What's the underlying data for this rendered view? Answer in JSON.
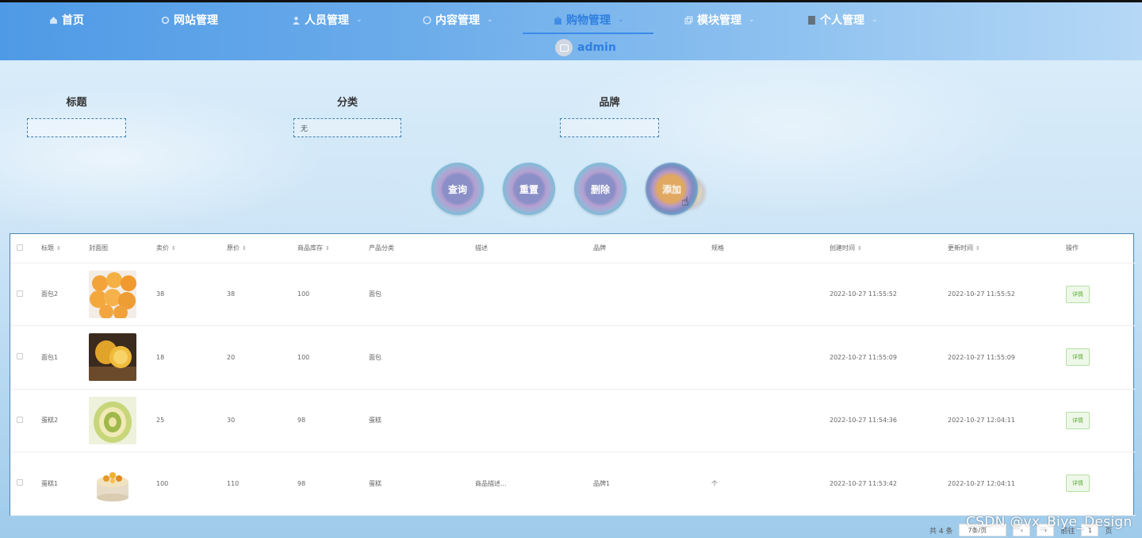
{
  "nav": {
    "items": [
      {
        "label": "首页",
        "icon": "home-icon"
      },
      {
        "label": "网站管理",
        "icon": "gear-icon"
      },
      {
        "label": "人员管理",
        "icon": "user-icon"
      },
      {
        "label": "内容管理",
        "icon": "chat-icon"
      },
      {
        "label": "购物管理",
        "icon": "bag-icon"
      },
      {
        "label": "模块管理",
        "icon": "copy-icon"
      },
      {
        "label": "个人管理",
        "icon": "doc-icon"
      }
    ],
    "active": "购物管理"
  },
  "user": {
    "name": "admin"
  },
  "search": {
    "title_label": "标题",
    "title_value": "",
    "category_label": "分类",
    "category_value": "无",
    "brand_label": "品牌",
    "brand_value": ""
  },
  "actions": {
    "query": "查询",
    "reset": "重置",
    "delete": "删除",
    "add": "添加"
  },
  "table": {
    "headers": [
      "标题",
      "封面图",
      "卖价",
      "原价",
      "商品库存",
      "产品分类",
      "描述",
      "品牌",
      "规格",
      "创建时间",
      "更新时间",
      "操作"
    ],
    "rows": [
      {
        "title": "面包2",
        "cover": "bread-buns",
        "price": "38",
        "orig": "38",
        "stock": "100",
        "category": "面包",
        "desc": "",
        "brand": "",
        "spec": "",
        "created": "2022-10-27 11:55:52",
        "updated": "2022-10-27 11:55:52",
        "action": "详情"
      },
      {
        "title": "面包1",
        "cover": "bread-halves",
        "price": "18",
        "orig": "20",
        "stock": "100",
        "category": "面包",
        "desc": "",
        "brand": "",
        "spec": "",
        "created": "2022-10-27 11:55:09",
        "updated": "2022-10-27 11:55:09",
        "action": "详情"
      },
      {
        "title": "蛋糕2",
        "cover": "cake-roll",
        "price": "25",
        "orig": "30",
        "stock": "98",
        "category": "蛋糕",
        "desc": "",
        "brand": "",
        "spec": "",
        "created": "2022-10-27 11:54:36",
        "updated": "2022-10-27 12:04:11",
        "action": "详情"
      },
      {
        "title": "蛋糕1",
        "cover": "round-cake",
        "price": "100",
        "orig": "110",
        "stock": "98",
        "category": "蛋糕",
        "desc": "商品描述...",
        "brand": "品牌1",
        "spec": "个",
        "created": "2022-10-27 11:53:42",
        "updated": "2022-10-27 12:04:11",
        "action": "详情"
      }
    ]
  },
  "pager": {
    "total": "共 4 条",
    "page_size": "7条/页",
    "goto": "前往",
    "page": "1",
    "page_suffix": "页"
  },
  "watermark": "CSDN @vx_Biye_Design"
}
